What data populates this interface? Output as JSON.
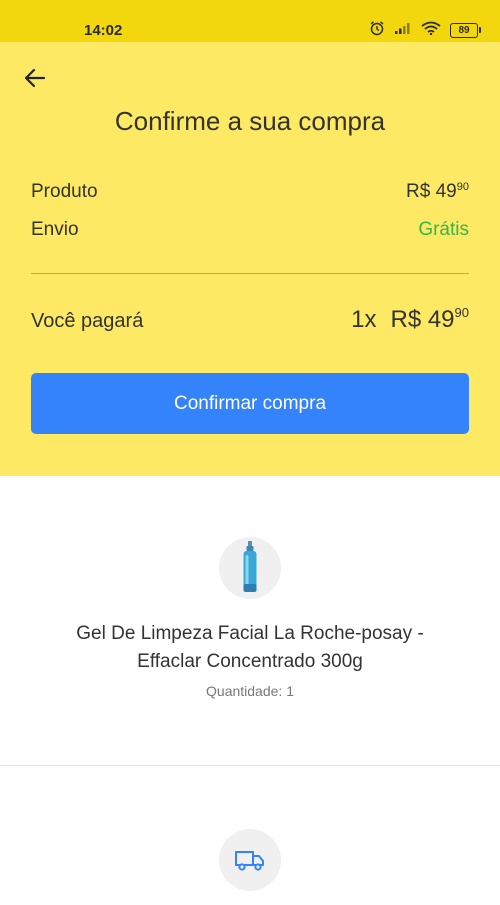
{
  "status_bar": {
    "time": "14:02",
    "battery": "89"
  },
  "header": {
    "title": "Confirme a sua compra",
    "product": {
      "label": "Produto",
      "price_main": "R$ 49",
      "price_cents": "90"
    },
    "shipping": {
      "label": "Envio",
      "value": "Grátis"
    },
    "total": {
      "label": "Você pagará",
      "quantity": "1x",
      "price_main": "R$ 49",
      "price_cents": "90"
    },
    "confirm_button": "Confirmar compra"
  },
  "product": {
    "name_line1": "Gel De Limpeza Facial La Roche-posay -",
    "name_line2": "Effaclar Concentrado 300g",
    "quantity": "Quantidade: 1",
    "image_icon": "product-bottle-icon"
  },
  "shipping_section": {
    "icon": "truck-icon"
  },
  "colors": {
    "header_background": "#fde963",
    "status_bar_background": "#f2d70f",
    "primary_button": "#3483fa",
    "free_shipping": "#39b54a"
  }
}
